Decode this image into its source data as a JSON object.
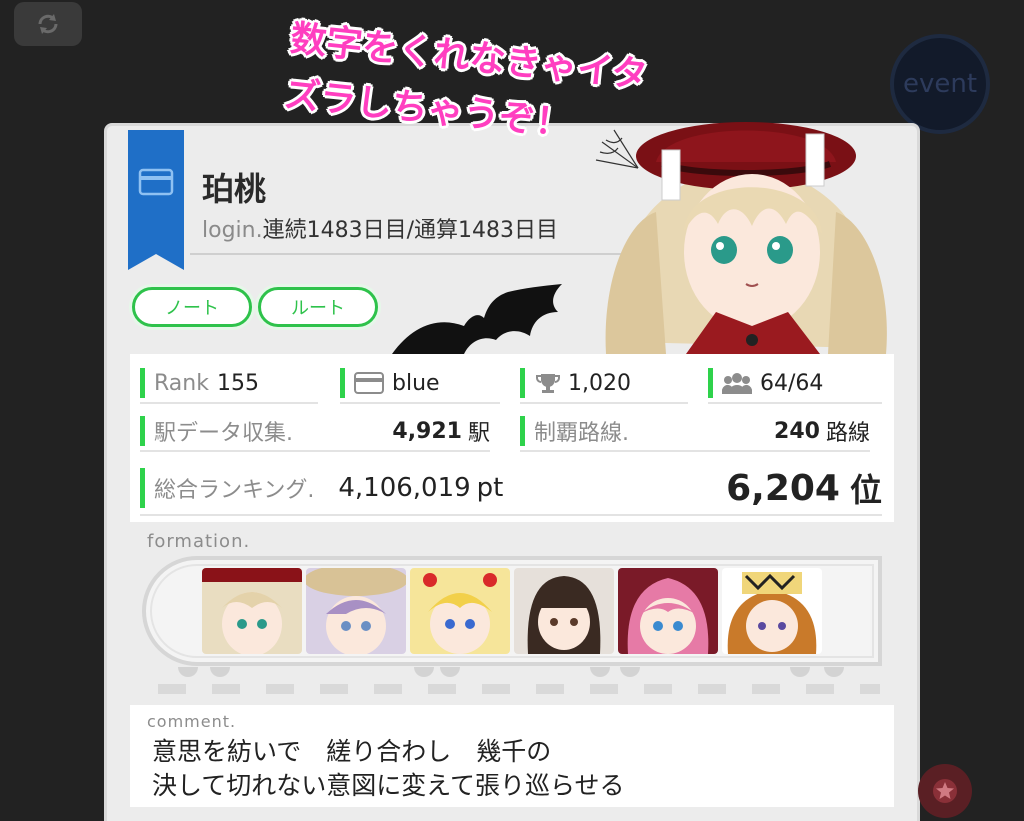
{
  "event_button": {
    "label": "event"
  },
  "profile": {
    "name": "珀桃",
    "login_prefix": "login.",
    "login_text": "連続1483日目/通算1483日目"
  },
  "tabs": [
    {
      "label": "ノート"
    },
    {
      "label": "ルート"
    }
  ],
  "speech": {
    "line1": "数字をくれなきゃイタ",
    "line2": "ズラしちゃうぞ！"
  },
  "stats": {
    "rank_label": "Rank",
    "rank_value": "155",
    "card_value": "blue",
    "trophy_value": "1,020",
    "friends_value": "64/64",
    "station_label": "駅データ収集.",
    "station_value": "4,921",
    "station_unit": "駅",
    "route_label": "制覇路線.",
    "route_value": "240",
    "route_unit": "路線",
    "ranking_label": "総合ランキング.",
    "ranking_points": "4,106,019",
    "ranking_points_unit": "pt",
    "ranking_position": "6,204",
    "ranking_position_unit": "位"
  },
  "formation": {
    "label": "formation."
  },
  "comment": {
    "label": "comment.",
    "body": "意思を紡いで　縒り合わし　幾千の\n決して切れない意図に変えて張り巡らせる"
  },
  "colors": {
    "accent_green": "#2ed24b",
    "ribbon_blue": "#1f6fc7",
    "pink": "#ff3ec0"
  }
}
